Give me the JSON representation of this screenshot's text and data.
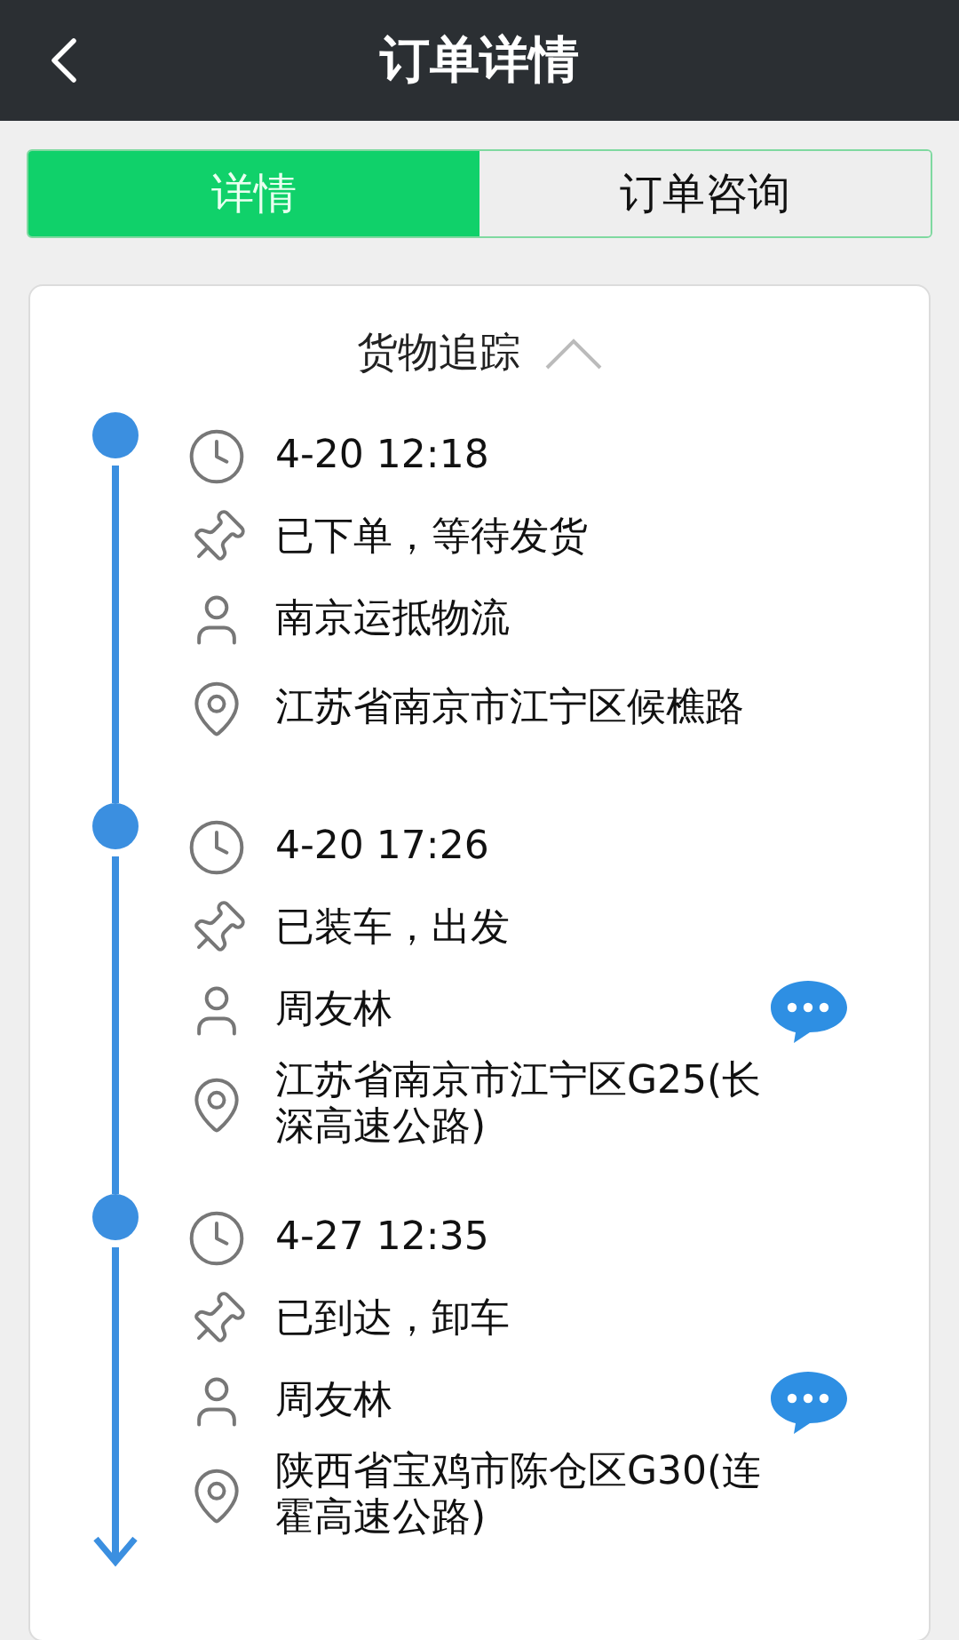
{
  "header": {
    "title": "订单详情"
  },
  "tabs": [
    {
      "label": "详情",
      "selected": true
    },
    {
      "label": "订单咨询",
      "selected": false
    }
  ],
  "tracking": {
    "title": "货物追踪",
    "expanded": true,
    "events": [
      {
        "time": "4-20 12:18",
        "status": "已下单，等待发货",
        "person": "南京运抵物流",
        "chat": false,
        "address": "江苏省南京市江宁区候樵路"
      },
      {
        "time": "4-20 17:26",
        "status": "已装车，出发",
        "person": "周友林",
        "chat": true,
        "address": "江苏省南京市江宁区G25(长深高速公路)"
      },
      {
        "time": "4-27 12:35",
        "status": "已到达，卸车",
        "person": "周友林",
        "chat": true,
        "address": "陕西省宝鸡市陈仓区G30(连霍高速公路)"
      }
    ]
  }
}
